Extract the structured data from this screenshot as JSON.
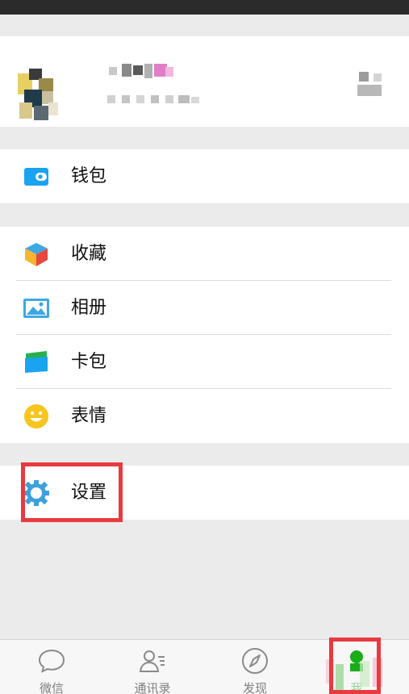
{
  "menu": {
    "wallet": "钱包",
    "favorites": "收藏",
    "album": "相册",
    "cards": "卡包",
    "stickers": "表情",
    "settings": "设置"
  },
  "tabs": {
    "chats": "微信",
    "contacts": "通讯录",
    "discover": "发现",
    "me": "我"
  },
  "colors": {
    "accent_green": "#1aad19",
    "highlight_red": "#e83a3f",
    "wallet_blue": "#1aa3f0",
    "settings_blue": "#3ea0dc"
  }
}
